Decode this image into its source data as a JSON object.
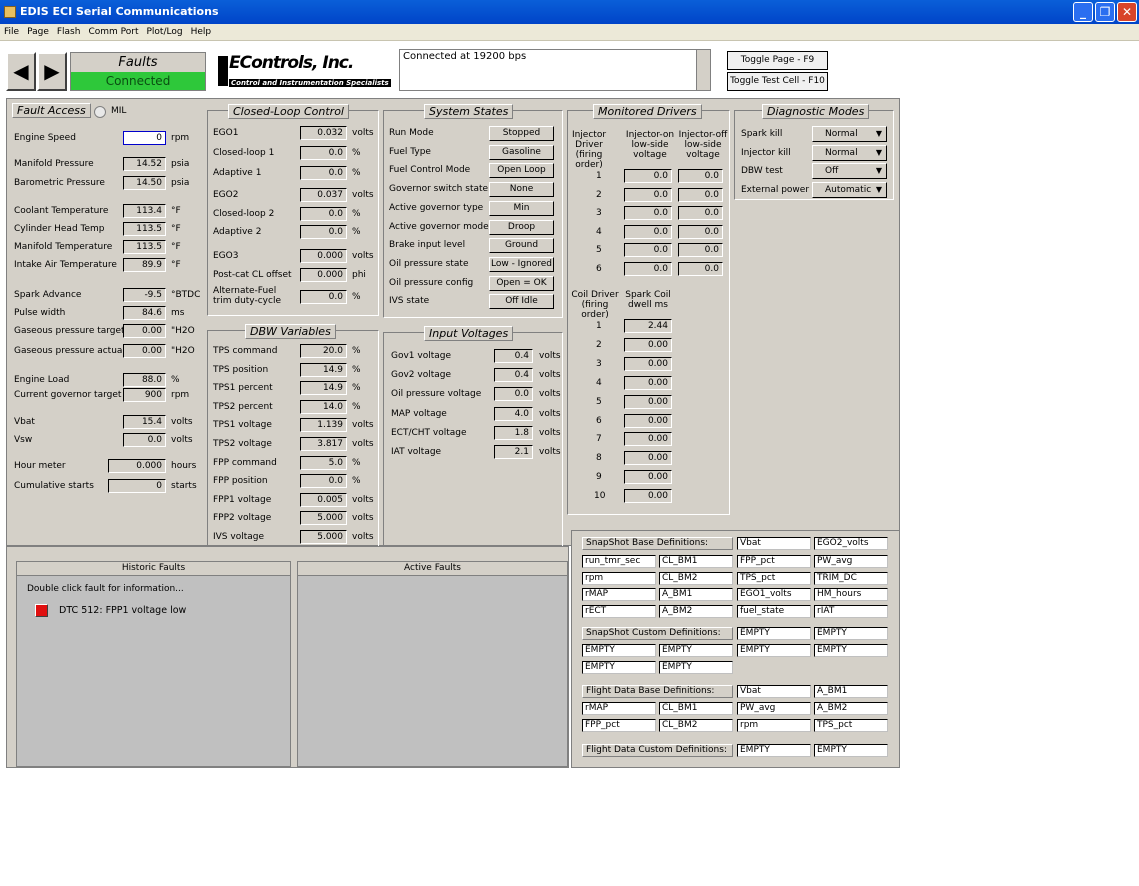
{
  "window": {
    "title": "EDIS ECI Serial Communications"
  },
  "menu": [
    "File",
    "Page",
    "Flash",
    "Comm Port",
    "Plot/Log",
    "Help"
  ],
  "header": {
    "page_title": "Faults",
    "connection_state": "Connected",
    "logo_main": "EControls, Inc.",
    "logo_sub": "Control and Instrumentation Specialists",
    "status_text": "Connected at 19200 bps",
    "toggle_page": "Toggle Page - F9",
    "toggle_test_cell": "Toggle Test Cell - F10"
  },
  "fault_access": {
    "title": "Fault Access",
    "mil_label": "MIL",
    "rows": [
      {
        "label": "Engine Speed",
        "value": "0",
        "unit": "rpm"
      },
      {
        "label": "Manifold Pressure",
        "value": "14.52",
        "unit": "psia"
      },
      {
        "label": "Barometric Pressure",
        "value": "14.50",
        "unit": "psia"
      },
      {
        "label": "Coolant Temperature",
        "value": "113.4",
        "unit": "°F"
      },
      {
        "label": "Cylinder Head Temp",
        "value": "113.5",
        "unit": "°F"
      },
      {
        "label": "Manifold Temperature",
        "value": "113.5",
        "unit": "°F"
      },
      {
        "label": "Intake Air Temperature",
        "value": "89.9",
        "unit": "°F"
      },
      {
        "label": "Spark Advance",
        "value": "-9.5",
        "unit": "°BTDC"
      },
      {
        "label": "Pulse width",
        "value": "84.6",
        "unit": "ms"
      },
      {
        "label": "Gaseous pressure target",
        "value": "0.00",
        "unit": "\"H2O"
      },
      {
        "label": "Gaseous pressure actual",
        "value": "0.00",
        "unit": "\"H2O"
      },
      {
        "label": "Engine Load",
        "value": "88.0",
        "unit": "%"
      },
      {
        "label": "Current governor target",
        "value": "900",
        "unit": "rpm"
      },
      {
        "label": "Vbat",
        "value": "15.4",
        "unit": "volts"
      },
      {
        "label": "Vsw",
        "value": "0.0",
        "unit": "volts"
      },
      {
        "label": "Hour meter",
        "value": "0.000",
        "unit": "hours"
      },
      {
        "label": "Cumulative starts",
        "value": "0",
        "unit": "starts"
      }
    ]
  },
  "closed_loop": {
    "title": "Closed-Loop Control",
    "rows": [
      {
        "label": "EGO1",
        "value": "0.032",
        "unit": "volts"
      },
      {
        "label": "Closed-loop 1",
        "value": "0.0",
        "unit": "%"
      },
      {
        "label": "Adaptive 1",
        "value": "0.0",
        "unit": "%"
      },
      {
        "label": "EGO2",
        "value": "0.037",
        "unit": "volts"
      },
      {
        "label": "Closed-loop 2",
        "value": "0.0",
        "unit": "%"
      },
      {
        "label": "Adaptive 2",
        "value": "0.0",
        "unit": "%"
      },
      {
        "label": "EGO3",
        "value": "0.000",
        "unit": "volts"
      },
      {
        "label": "Post-cat CL offset",
        "value": "0.000",
        "unit": "phi"
      },
      {
        "label": "Alternate-Fuel trim duty-cycle",
        "value": "0.0",
        "unit": "%"
      }
    ]
  },
  "dbw": {
    "title": "DBW Variables",
    "rows": [
      {
        "label": "TPS command",
        "value": "20.0",
        "unit": "%"
      },
      {
        "label": "TPS position",
        "value": "14.9",
        "unit": "%"
      },
      {
        "label": "TPS1 percent",
        "value": "14.9",
        "unit": "%"
      },
      {
        "label": "TPS2 percent",
        "value": "14.0",
        "unit": "%"
      },
      {
        "label": "TPS1 voltage",
        "value": "1.139",
        "unit": "volts"
      },
      {
        "label": "TPS2 voltage",
        "value": "3.817",
        "unit": "volts"
      },
      {
        "label": "FPP command",
        "value": "5.0",
        "unit": "%"
      },
      {
        "label": "FPP position",
        "value": "0.0",
        "unit": "%"
      },
      {
        "label": "FPP1 voltage",
        "value": "0.005",
        "unit": "volts"
      },
      {
        "label": "FPP2 voltage",
        "value": "5.000",
        "unit": "volts"
      },
      {
        "label": "IVS voltage",
        "value": "5.000",
        "unit": "volts"
      }
    ]
  },
  "system_states": {
    "title": "System States",
    "rows": [
      {
        "label": "Run Mode",
        "value": "Stopped"
      },
      {
        "label": "Fuel Type",
        "value": "Gasoline"
      },
      {
        "label": "Fuel Control Mode",
        "value": "Open Loop"
      },
      {
        "label": "Governor switch state",
        "value": "None"
      },
      {
        "label": "Active governor type",
        "value": "Min"
      },
      {
        "label": "Active governor mode",
        "value": "Droop"
      },
      {
        "label": "Brake input level",
        "value": "Ground"
      },
      {
        "label": "Oil pressure state",
        "value": "Low - Ignored"
      },
      {
        "label": "Oil pressure config",
        "value": "Open = OK"
      },
      {
        "label": "IVS state",
        "value": "Off Idle"
      }
    ]
  },
  "input_voltages": {
    "title": "Input Voltages",
    "rows": [
      {
        "label": "Gov1 voltage",
        "value": "0.4",
        "unit": "volts"
      },
      {
        "label": "Gov2 voltage",
        "value": "0.4",
        "unit": "volts"
      },
      {
        "label": "Oil pressure voltage",
        "value": "0.0",
        "unit": "volts"
      },
      {
        "label": "MAP voltage",
        "value": "4.0",
        "unit": "volts"
      },
      {
        "label": "ECT/CHT voltage",
        "value": "1.8",
        "unit": "volts"
      },
      {
        "label": "IAT voltage",
        "value": "2.1",
        "unit": "volts"
      }
    ]
  },
  "monitored_drivers": {
    "title": "Monitored Drivers",
    "inj_col1": "Injector Driver (firing order)",
    "inj_col2": "Injector-on low-side voltage",
    "inj_col3": "Injector-off low-side voltage",
    "injectors": [
      {
        "n": "1",
        "on": "0.0",
        "off": "0.0"
      },
      {
        "n": "2",
        "on": "0.0",
        "off": "0.0"
      },
      {
        "n": "3",
        "on": "0.0",
        "off": "0.0"
      },
      {
        "n": "4",
        "on": "0.0",
        "off": "0.0"
      },
      {
        "n": "5",
        "on": "0.0",
        "off": "0.0"
      },
      {
        "n": "6",
        "on": "0.0",
        "off": "0.0"
      }
    ],
    "coil_col1": "Coil Driver (firing order)",
    "coil_col2": "Spark Coil dwell ms",
    "coils": [
      {
        "n": "1",
        "dwell": "2.44"
      },
      {
        "n": "2",
        "dwell": "0.00"
      },
      {
        "n": "3",
        "dwell": "0.00"
      },
      {
        "n": "4",
        "dwell": "0.00"
      },
      {
        "n": "5",
        "dwell": "0.00"
      },
      {
        "n": "6",
        "dwell": "0.00"
      },
      {
        "n": "7",
        "dwell": "0.00"
      },
      {
        "n": "8",
        "dwell": "0.00"
      },
      {
        "n": "9",
        "dwell": "0.00"
      },
      {
        "n": "10",
        "dwell": "0.00"
      }
    ]
  },
  "diagnostic_modes": {
    "title": "Diagnostic Modes",
    "rows": [
      {
        "label": "Spark kill",
        "value": "Normal"
      },
      {
        "label": "Injector kill",
        "value": "Normal"
      },
      {
        "label": "DBW test",
        "value": "Off"
      },
      {
        "label": "External power",
        "value": "Automatic"
      }
    ]
  },
  "snapshot": {
    "base_header": "SnapShot Base Definitions:",
    "base_cells": [
      "Vbat",
      "EGO2_volts",
      "run_tmr_sec",
      "CL_BM1",
      "FPP_pct",
      "PW_avg",
      "rpm",
      "CL_BM2",
      "TPS_pct",
      "TRIM_DC",
      "rMAP",
      "A_BM1",
      "EGO1_volts",
      "HM_hours",
      "rECT",
      "A_BM2",
      "fuel_state",
      "rIAT"
    ],
    "custom_header": "SnapShot Custom Definitions:",
    "custom_cells": [
      "EMPTY",
      "EMPTY",
      "EMPTY",
      "EMPTY",
      "EMPTY",
      "EMPTY",
      "EMPTY",
      "EMPTY"
    ],
    "flight_base_header": "Flight Data Base Definitions:",
    "flight_base_cells": [
      "Vbat",
      "A_BM1",
      "rMAP",
      "CL_BM1",
      "PW_avg",
      "A_BM2",
      "FPP_pct",
      "CL_BM2",
      "rpm",
      "TPS_pct"
    ],
    "flight_custom_header": "Flight Data Custom Definitions:",
    "flight_custom_cells": [
      "EMPTY",
      "EMPTY"
    ]
  },
  "historic_faults": {
    "title": "Historic Faults",
    "hint": "Double click fault for information...",
    "items": [
      "DTC 512: FPP1 voltage low"
    ]
  },
  "active_faults": {
    "title": "Active Faults"
  },
  "colors": {
    "titlebar": "#0044c8",
    "connected": "#2ec83a",
    "panel": "#d4d0c8",
    "fault_indicator": "#e01010"
  }
}
